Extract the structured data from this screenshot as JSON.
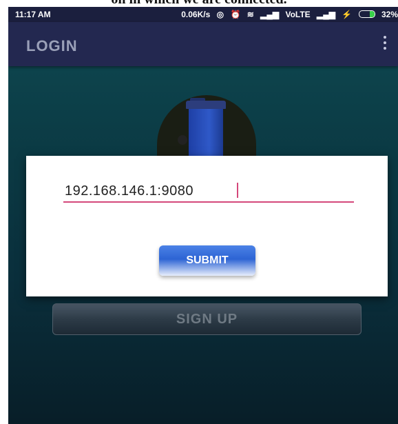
{
  "caption": "on in which we are connected.",
  "status_bar": {
    "time": "11:17 AM",
    "speed": "0.06K/s",
    "network": "VoLTE",
    "battery": "32%"
  },
  "app_bar": {
    "title": "LOGIN"
  },
  "dialog": {
    "ip_value": "192.168.146.1:9080",
    "submit_label": "SUBMIT"
  },
  "signup_label": "SIGN UP",
  "colors": {
    "status_bar": "#1b1f3e",
    "app_bar": "#232850",
    "background": "#0b3a44",
    "accent": "#d4477a",
    "button": "#2d64d4"
  }
}
